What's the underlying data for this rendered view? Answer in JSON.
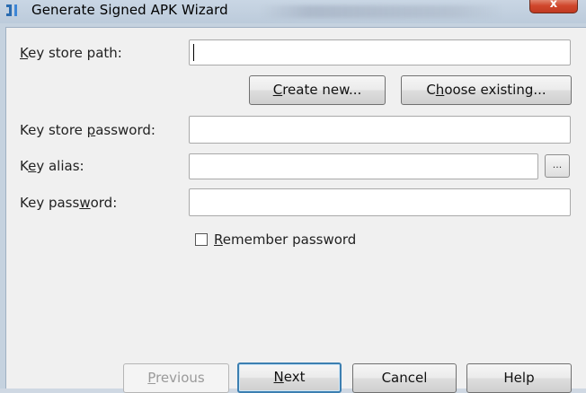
{
  "window": {
    "title": "Generate Signed APK Wizard",
    "close_label": "x"
  },
  "form": {
    "key_store_path": {
      "label_pre": "",
      "label_mn": "K",
      "label_post": "ey store path:",
      "value": ""
    },
    "create_new": {
      "pre": "",
      "mn": "C",
      "post": "reate new..."
    },
    "choose_existing": {
      "pre": "C",
      "mn": "h",
      "post": "oose existing..."
    },
    "key_store_password": {
      "label_pre": "Key store ",
      "label_mn": "p",
      "label_post": "assword:",
      "value": ""
    },
    "key_alias": {
      "label_pre": "K",
      "label_mn": "e",
      "label_post": "y alias:",
      "value": "",
      "browse_label": "..."
    },
    "key_password": {
      "label_pre": "Key pass",
      "label_mn": "w",
      "label_post": "ord:",
      "value": ""
    },
    "remember_password": {
      "pre": "",
      "mn": "R",
      "post": "emember password",
      "checked": false
    }
  },
  "buttons": {
    "previous": {
      "pre": "",
      "mn": "P",
      "post": "revious",
      "enabled": false
    },
    "next": {
      "pre": "",
      "mn": "N",
      "post": "ext",
      "enabled": true
    },
    "cancel": {
      "label": "Cancel"
    },
    "help": {
      "label": "Help"
    }
  }
}
